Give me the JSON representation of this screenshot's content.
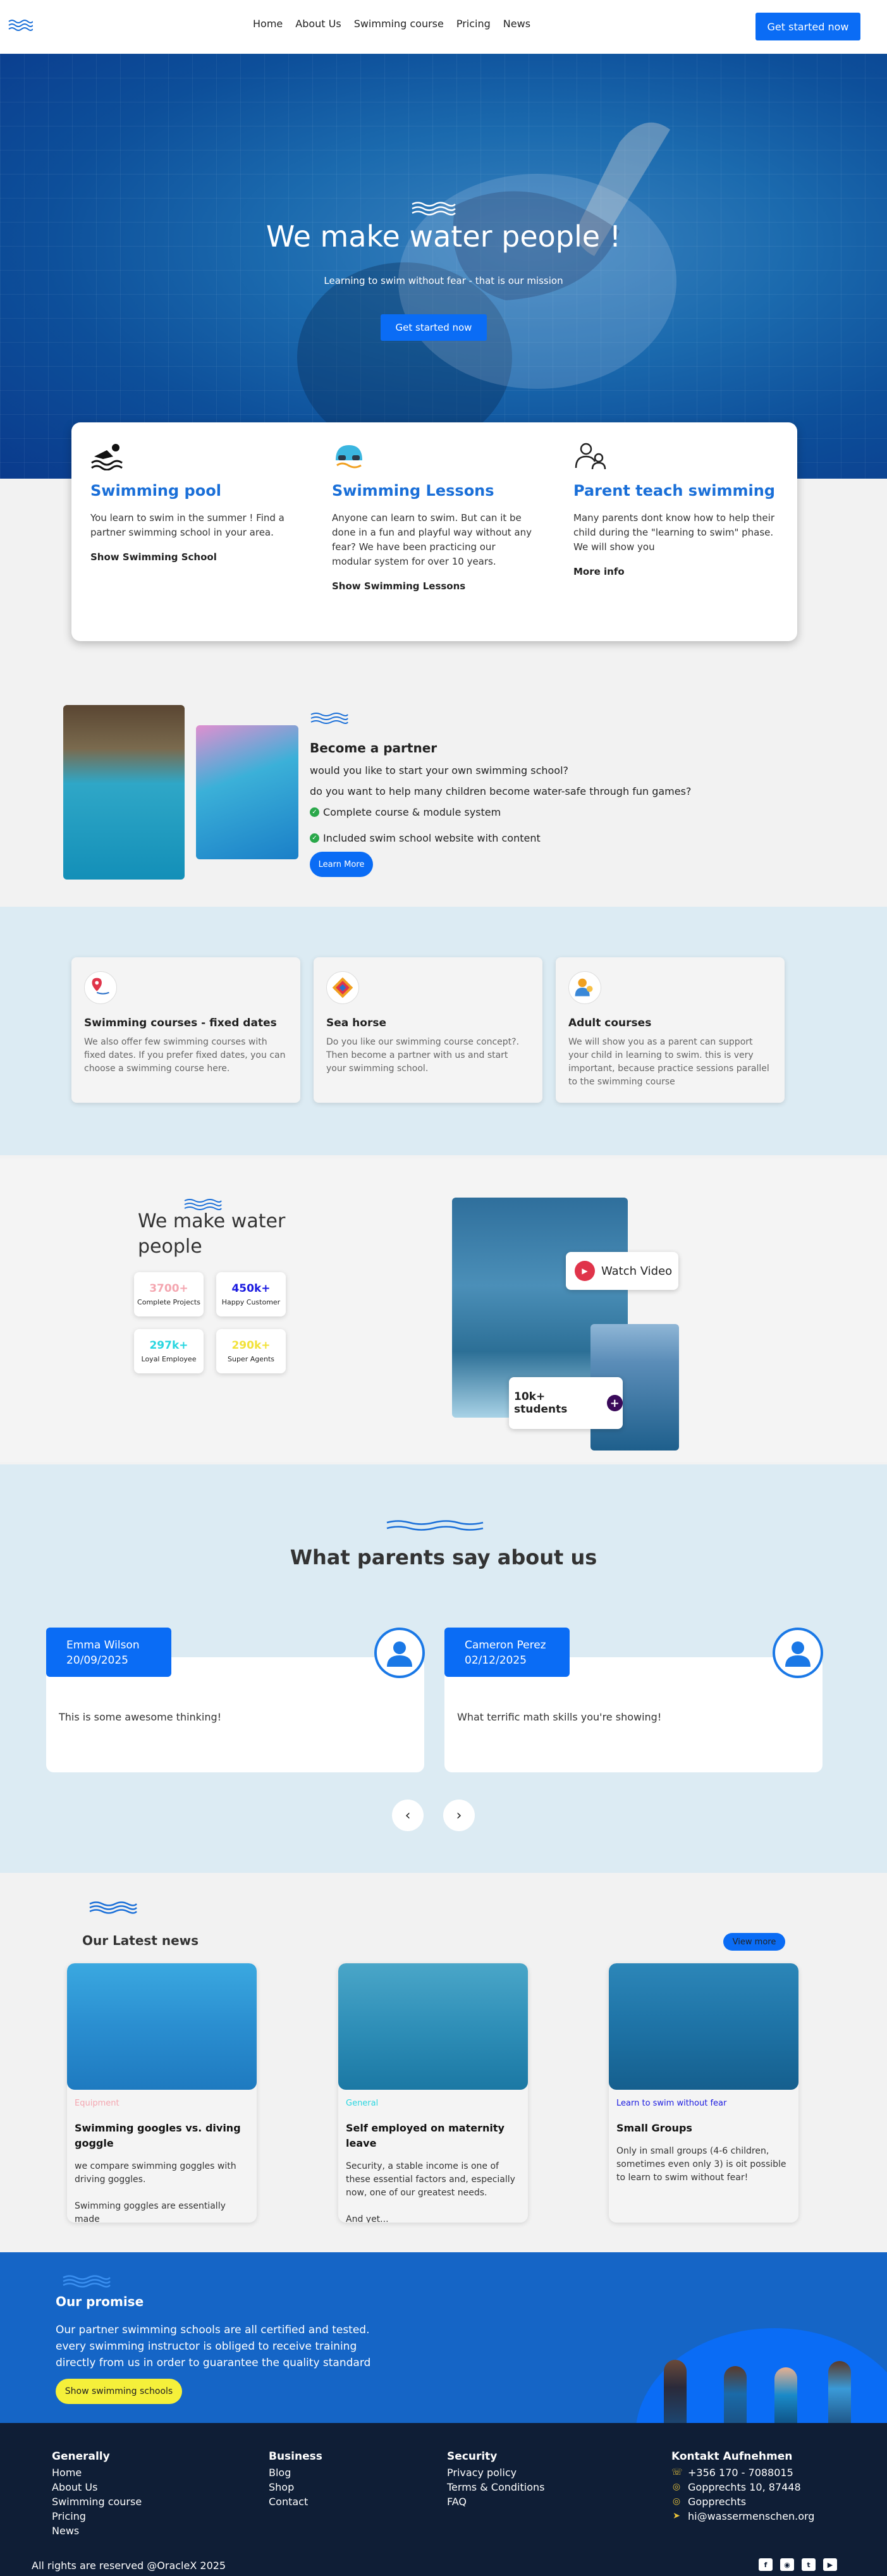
{
  "nav": {
    "links": [
      "Home",
      "About Us",
      "Swimming course",
      "Pricing",
      "News"
    ],
    "cta": "Get started now"
  },
  "hero": {
    "title": "We make water people !",
    "subtitle": "Learning to swim without fear - that is our mission",
    "button": "Get started now"
  },
  "features": [
    {
      "icon": "swimmer-icon",
      "title": "Swimming pool",
      "text": "You learn to swim in the summer ! Find a partner swimming school in your area.",
      "link": "Show Swimming School"
    },
    {
      "icon": "swim-cap-icon",
      "title": "Swimming Lessons",
      "text": "Anyone can learn to swim. But can it be done in a fun and playful way without any fear? We have been practicing our modular system for over 10 years.",
      "link": "Show Swimming Lessons"
    },
    {
      "icon": "parent-child-icon",
      "title": "Parent teach swimming",
      "text": "Many parents dont know how to help their child during the \"learning to swim\" phase. We will show you",
      "link": "More info"
    }
  ],
  "partner": {
    "title": "Become a partner",
    "lines": [
      "would you like to start your own swimming school?",
      "do you want to help many children become water-safe through fun games?"
    ],
    "checks": [
      "Complete course & module system",
      "Included swim school website with content"
    ],
    "button": "Learn More"
  },
  "courses": [
    {
      "icon": "location-pin-icon",
      "title": "Swimming courses - fixed dates",
      "text": "We also offer few swimming courses with fixed dates. If you prefer fixed dates, you can choose a swimming course here."
    },
    {
      "icon": "sea-horse-icon",
      "title": "Sea horse",
      "text": "Do you like our swimming course concept?. Then become a partner with us and start your swimming school."
    },
    {
      "icon": "adult-icon",
      "title": "Adult courses",
      "text": "We will show you as a parent can support your child in learning to swim. this is very important, because practice sessions parallel to the swimming course"
    }
  ],
  "stats": {
    "title": "We make water people",
    "items": [
      {
        "value": "3700+",
        "label": "Complete Projects",
        "color": "#f4a6b0"
      },
      {
        "value": "450k+",
        "label": "Happy Customer",
        "color": "#1a1ae0"
      },
      {
        "value": "297k+",
        "label": "Loyal Employee",
        "color": "#29d6e0"
      },
      {
        "value": "290k+",
        "label": "Super Agents",
        "color": "#f2e23a"
      }
    ],
    "watch_label": "Watch Video",
    "students_label": "10k+ students"
  },
  "testimonials": {
    "title": "What parents say about us",
    "items": [
      {
        "name": "Emma Wilson",
        "date": "20/09/2025",
        "text": "This is some awesome thinking!"
      },
      {
        "name": "Cameron Perez",
        "date": "02/12/2025",
        "text": "What terrific math skills you're showing!"
      }
    ],
    "prev": "‹",
    "next": "›"
  },
  "news": {
    "title": "Our Latest news",
    "view_more": "View more",
    "items": [
      {
        "category": "Equipment",
        "cat_color": "#f4a6b0",
        "title": "Swimming googles vs. diving goggle",
        "text": "we compare swimming goggles with driving goggles.\n\nSwimming goggles are essentially made"
      },
      {
        "category": "General",
        "cat_color": "#29d6e0",
        "title": "Self employed on maternity leave",
        "text": "Security, a stable income is one of these essential factors and, especially now, one of our greatest needs.\n\nAnd yet..."
      },
      {
        "category": "Learn to swim without fear",
        "cat_color": "#1a1ae0",
        "title": "Small Groups",
        "text": "Only in small groups (4-6 children, sometimes even only 3) is oit possible to learn to swim without fear!"
      }
    ]
  },
  "promise": {
    "title": "Our promise",
    "text": "Our partner swimming schools are all certified and tested. every swimming instructor is obliged to receive training directly from us in order to guarantee the quality standard",
    "button": "Show swimming schools"
  },
  "footer": {
    "generally": {
      "title": "Generally",
      "items": [
        "Home",
        "About Us",
        "Swimming course",
        "Pricing",
        "News"
      ]
    },
    "business": {
      "title": "Business",
      "items": [
        "Blog",
        "Shop",
        "Contact"
      ]
    },
    "security": {
      "title": "Security",
      "items": [
        "Privacy policy",
        "Terms & Conditions",
        "FAQ"
      ]
    },
    "contact": {
      "title": "Kontakt Aufnehmen",
      "items": [
        "+356 170 - 7088015",
        "Gopprechts 10, 87448",
        "Gopprechts",
        "hi@wassermenschen.org"
      ]
    },
    "copyright": "All rights are reserved @OracleX 2025",
    "social": [
      "facebook-icon",
      "instagram-icon",
      "twitter-icon",
      "youtube-icon"
    ]
  }
}
